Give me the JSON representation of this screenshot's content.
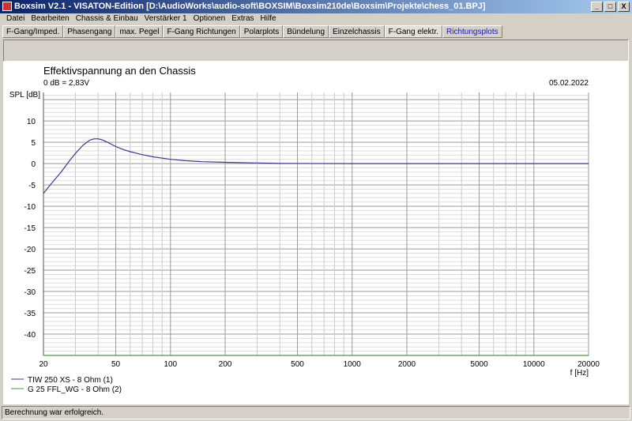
{
  "window": {
    "title": "Boxsim V2.1 - VISATON-Edition [D:\\AudioWorks\\audio-soft\\BOXSIM\\Boxsim210de\\Boxsim\\Projekte\\chess_01.BPJ]",
    "buttons": [
      "_",
      "□",
      "X"
    ]
  },
  "menu": [
    "Datei",
    "Bearbeiten",
    "Chassis & Einbau",
    "Verstärker 1",
    "Optionen",
    "Extras",
    "Hilfe"
  ],
  "tabs": [
    {
      "label": "F-Gang/Imped."
    },
    {
      "label": "Phasengang"
    },
    {
      "label": "max. Pegel"
    },
    {
      "label": "F-Gang Richtungen"
    },
    {
      "label": "Polarplots"
    },
    {
      "label": "Bündelung"
    },
    {
      "label": "Einzelchassis"
    },
    {
      "label": "F-Gang elektr.",
      "active": true
    },
    {
      "label": "Richtungsplots",
      "link": true
    }
  ],
  "status": "Berechnung war erfolgreich.",
  "chart_data": {
    "type": "line",
    "title": "Effektivspannung an den Chassis",
    "subtitle": "0 dB = 2,83V",
    "date": "05.02.2022",
    "ylabel": "SPL [dB]",
    "xlabel": "f [Hz]",
    "xscale": "log",
    "xlim": [
      20,
      20000
    ],
    "ylim": [
      -45,
      16.7
    ],
    "xticks": [
      20,
      50,
      100,
      200,
      500,
      1000,
      2000,
      5000,
      10000,
      20000
    ],
    "xtick_labels": [
      "20",
      "50",
      "100",
      "200",
      "500",
      "1000",
      "2000",
      "5000",
      "10000",
      "20000"
    ],
    "yticks": [
      10,
      5,
      0,
      -5,
      -10,
      -15,
      -20,
      -25,
      -30,
      -35,
      -40
    ],
    "ytick_labels": [
      "10",
      "5",
      "0",
      "-5",
      "-10",
      "-15",
      "-20",
      "-25",
      "-30",
      "-35",
      "-40"
    ],
    "grid": true,
    "legend_position": "bottom-left",
    "series": [
      {
        "name": "TIW 250 XS - 8 Ohm (1)",
        "color": "#3a3a8c",
        "x": [
          20,
          22,
          25,
          28,
          30,
          33,
          36,
          38,
          40,
          42,
          45,
          50,
          55,
          60,
          70,
          80,
          100,
          120,
          150,
          200,
          300,
          400,
          1000,
          20000
        ],
        "y": [
          -7,
          -4.8,
          -2,
          0.8,
          2.4,
          4.3,
          5.5,
          5.8,
          5.8,
          5.6,
          5,
          4,
          3.3,
          2.8,
          2.1,
          1.6,
          1,
          0.7,
          0.45,
          0.3,
          0.15,
          0.05,
          0,
          0
        ]
      },
      {
        "name": "G 25 FFL_WG - 8 Ohm (2)",
        "color": "#4a9a3a",
        "x": [
          20,
          20000
        ],
        "y": [
          -45,
          -45
        ]
      }
    ]
  }
}
